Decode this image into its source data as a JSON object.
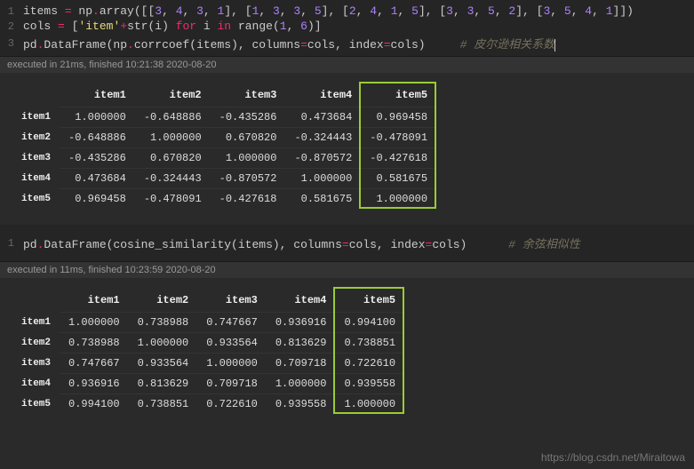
{
  "cell1": {
    "lines": [
      "1",
      "2",
      "3"
    ],
    "code1_html": "items <span class='s-op'>=</span> np<span class='s-op'>.</span>array([[<span class='s-num'>3</span>, <span class='s-num'>4</span>, <span class='s-num'>3</span>, <span class='s-num'>1</span>], [<span class='s-num'>1</span>, <span class='s-num'>3</span>, <span class='s-num'>3</span>, <span class='s-num'>5</span>], [<span class='s-num'>2</span>, <span class='s-num'>4</span>, <span class='s-num'>1</span>, <span class='s-num'>5</span>], [<span class='s-num'>3</span>, <span class='s-num'>3</span>, <span class='s-num'>5</span>, <span class='s-num'>2</span>], [<span class='s-num'>3</span>, <span class='s-num'>5</span>, <span class='s-num'>4</span>, <span class='s-num'>1</span>]])",
    "code2_html": "cols <span class='s-op'>=</span> [<span class='s-str'>'item'</span><span class='s-op'>+</span><span class='s-call'>str</span>(i) <span class='s-kw'>for</span> i <span class='s-kw'>in</span> <span class='s-call'>range</span>(<span class='s-num'>1</span>, <span class='s-num'>6</span>)]",
    "code3_html": "pd<span class='s-op'>.</span>DataFrame(np<span class='s-op'>.</span>corrcoef(items), columns<span class='s-op'>=</span>cols, index<span class='s-op'>=</span>cols)     <span class='s-comment'># 皮尔逊相关系数</span><span class='cursor'></span>",
    "exec": "executed in 21ms, finished 10:21:38 2020-08-20"
  },
  "cell2": {
    "lines": [
      "1"
    ],
    "code1_html": "pd<span class='s-op'>.</span>DataFrame(cosine_similarity(items), columns<span class='s-op'>=</span>cols, index<span class='s-op'>=</span>cols)      <span class='s-comment'># 余弦相似性</span>",
    "exec": "executed in 11ms, finished 10:23:59 2020-08-20"
  },
  "chart_data": [
    {
      "type": "table",
      "title": "Pearson correlation coefficients",
      "columns": [
        "item1",
        "item2",
        "item3",
        "item4",
        "item5"
      ],
      "index": [
        "item1",
        "item2",
        "item3",
        "item4",
        "item5"
      ],
      "values": [
        [
          1.0,
          -0.648886,
          -0.435286,
          0.473684,
          0.969458
        ],
        [
          -0.648886,
          1.0,
          0.67082,
          -0.324443,
          -0.478091
        ],
        [
          -0.435286,
          0.67082,
          1.0,
          -0.870572,
          -0.427618
        ],
        [
          0.473684,
          -0.324443,
          -0.870572,
          1.0,
          0.581675
        ],
        [
          0.969458,
          -0.478091,
          -0.427618,
          0.581675,
          1.0
        ]
      ]
    },
    {
      "type": "table",
      "title": "Cosine similarity",
      "columns": [
        "item1",
        "item2",
        "item3",
        "item4",
        "item5"
      ],
      "index": [
        "item1",
        "item2",
        "item3",
        "item4",
        "item5"
      ],
      "values": [
        [
          1.0,
          0.738988,
          0.747667,
          0.936916,
          0.9941
        ],
        [
          0.738988,
          1.0,
          0.933564,
          0.813629,
          0.738851
        ],
        [
          0.747667,
          0.933564,
          1.0,
          0.709718,
          0.72261
        ],
        [
          0.936916,
          0.813629,
          0.709718,
          1.0,
          0.939558
        ],
        [
          0.9941,
          0.738851,
          0.72261,
          0.939558,
          1.0
        ]
      ]
    }
  ],
  "watermark": "https://blog.csdn.net/Miraitowa"
}
